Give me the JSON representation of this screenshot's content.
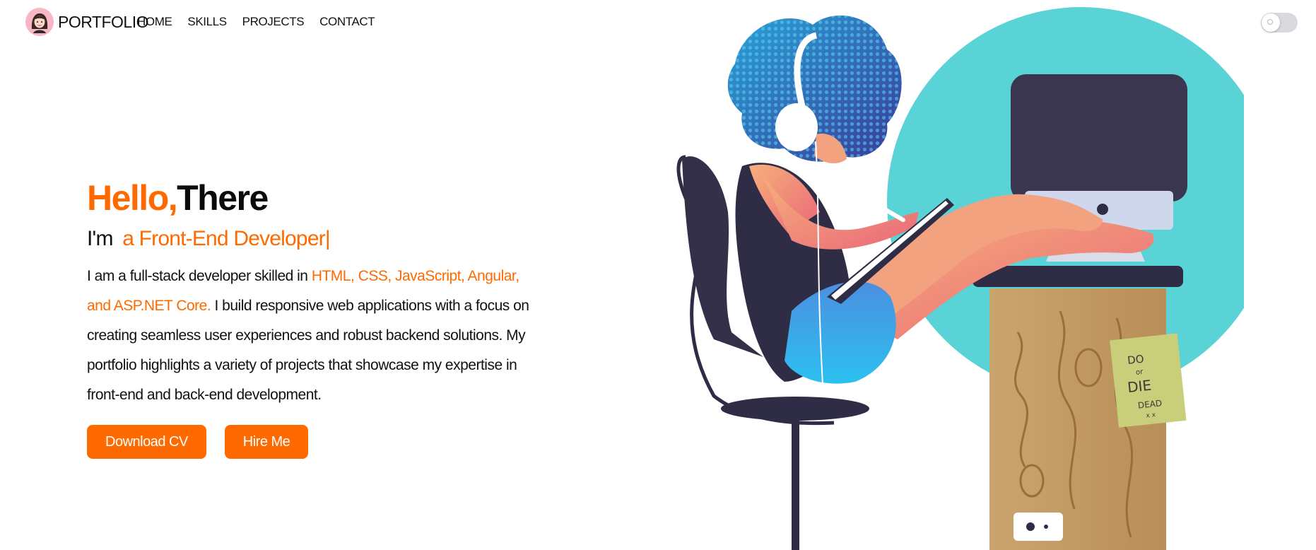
{
  "brand": {
    "name": "PORTFOLIO",
    "avatar_icon": "girl-avatar-icon"
  },
  "nav": {
    "items": [
      {
        "label": "HOME"
      },
      {
        "label": "SKILLS"
      },
      {
        "label": "PROJECTS"
      },
      {
        "label": "CONTACT"
      }
    ]
  },
  "theme_toggle": {
    "state": "off",
    "icon": "sun-toggle-icon"
  },
  "hero": {
    "greeting_hello": "Hello,",
    "greeting_there": "There",
    "intro_prefix": "I'm",
    "role": "a Front-End Developer",
    "cursor": "|",
    "bio_start": "I am a full-stack developer skilled in ",
    "bio_skills": "HTML, CSS, JavaScript, Angular, and ASP.NET Core.",
    "bio_end": " I build responsive web applications with a focus on creating seamless user experiences and robust backend solutions. My portfolio highlights a variety of projects that showcase my expertise in front-end and back-end development.",
    "download_cv_label": "Download CV",
    "hire_me_label": "Hire Me"
  },
  "illustration": {
    "note_line1": "DO",
    "note_line2": "or",
    "note_line3": "DIE",
    "note_line4": "DEAD",
    "note_line5": "x x"
  },
  "colors": {
    "accent": "#ff6a00",
    "circle": "#5ad3d7",
    "monitor": "#3b3650",
    "desk_top": "#2f2c45",
    "desk_wood": "#c9a36f"
  }
}
